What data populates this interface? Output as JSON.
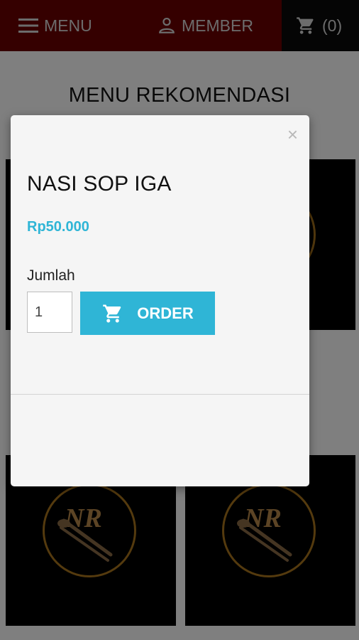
{
  "header": {
    "menu_label": "MENU",
    "member_label": "MEMBER",
    "cart_count": "(0)"
  },
  "page": {
    "title": "MENU REKOMENDASI",
    "logo_text": "NR"
  },
  "modal": {
    "close_symbol": "×",
    "product_name": "NASI SOP IGA",
    "price": "Rp50.000",
    "quantity_label": "Jumlah",
    "quantity_value": "1",
    "order_label": "ORDER"
  },
  "colors": {
    "header_bg": "#6b0000",
    "cart_bg": "#0a0a0a",
    "accent": "#2fb5d6"
  },
  "icons": [
    "hamburger-icon",
    "user-icon",
    "cart-icon",
    "close-icon"
  ]
}
